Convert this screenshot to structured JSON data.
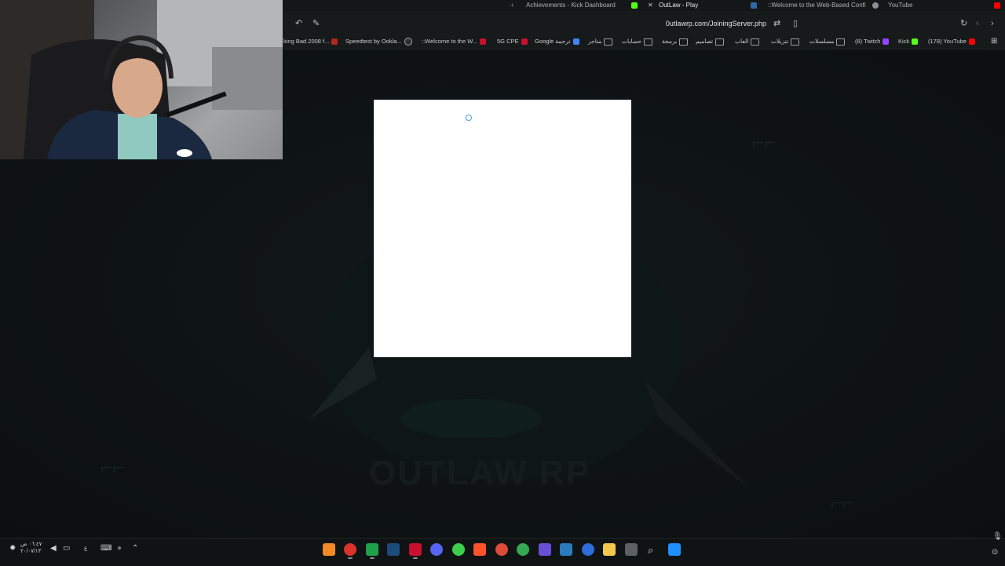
{
  "tabs": [
    {
      "label": "Achievements - Kick Dashboard"
    },
    {
      "label": "OutLaw - Play"
    },
    {
      "label": "::Welcome to the Web-Based Confi"
    },
    {
      "label": "YouTube"
    }
  ],
  "address_bar": {
    "url": "0utlawrp.com/JoiningServer.php"
  },
  "bookmarks": [
    {
      "label": "king Bad 2008 f..."
    },
    {
      "label": "Speedtest by Ookla..."
    },
    {
      "label": "::Welcome to the W..."
    },
    {
      "label": "5G CPE"
    },
    {
      "label": "Google ترجمة"
    },
    {
      "label": "متاجر"
    },
    {
      "label": "حسابات"
    },
    {
      "label": "برمجة"
    },
    {
      "label": "تصاميم"
    },
    {
      "label": "العاب"
    },
    {
      "label": "تنزيلات"
    },
    {
      "label": "مسلسلات"
    },
    {
      "label": "(6) Twitch"
    },
    {
      "label": "Kick"
    },
    {
      "label": "(178) YouTube"
    }
  ],
  "page": {
    "watermark": "OUTLAW RP"
  },
  "taskbar": {
    "time": "٠٦:٤٧ ص",
    "date": "٢٠/٠٧/١٣",
    "lang": "ع"
  },
  "colors": {
    "kick": "#53fc18",
    "twitch": "#9146ff",
    "youtube": "#ff0000",
    "loading_box": "#ffffff"
  }
}
